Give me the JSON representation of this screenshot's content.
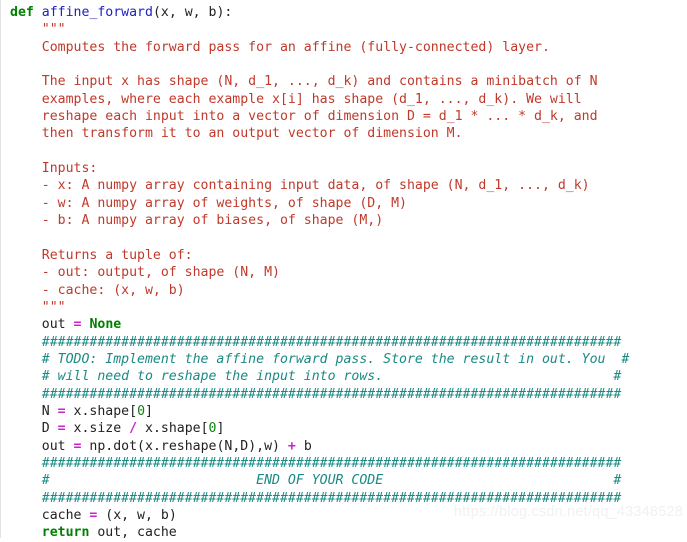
{
  "editor": {
    "language": "python",
    "background_color": "#ffffff",
    "gutter_border_color": "#e3e3e3",
    "theme_colors": {
      "keyword": "#008000",
      "function_name": "#2020c0",
      "string": "#c0392b",
      "comment": "#1a8a84",
      "operator": "#cc22cc",
      "number": "#108010",
      "plain_text": "#222222"
    }
  },
  "watermark": {
    "text": "https://blog.csdn.net/qq_43348528",
    "color": "#f1f1f1"
  },
  "code": {
    "lines": [
      {
        "id": "l1",
        "segments": [
          {
            "t": "def",
            "c": "keyword"
          },
          {
            "t": " ",
            "c": "plain"
          },
          {
            "t": "affine_forward",
            "c": "funcname"
          },
          {
            "t": "(x, w, b):",
            "c": "plain"
          }
        ]
      },
      {
        "id": "l2",
        "segments": [
          {
            "t": "    \"\"\"",
            "c": "string"
          }
        ]
      },
      {
        "id": "l3",
        "segments": [
          {
            "t": "    Computes the forward pass for an affine (fully-connected) layer.",
            "c": "string"
          }
        ]
      },
      {
        "id": "l4",
        "segments": [
          {
            "t": "",
            "c": "string"
          }
        ]
      },
      {
        "id": "l5",
        "segments": [
          {
            "t": "    The input x has shape (N, d_1, ..., d_k) and contains a minibatch of N",
            "c": "string"
          }
        ]
      },
      {
        "id": "l6",
        "segments": [
          {
            "t": "    examples, where each example x[i] has shape (d_1, ..., d_k). We will",
            "c": "string"
          }
        ]
      },
      {
        "id": "l7",
        "segments": [
          {
            "t": "    reshape each input into a vector of dimension D = d_1 * ... * d_k, and",
            "c": "string"
          }
        ]
      },
      {
        "id": "l8",
        "segments": [
          {
            "t": "    then transform it to an output vector of dimension M.",
            "c": "string"
          }
        ]
      },
      {
        "id": "l9",
        "segments": [
          {
            "t": "",
            "c": "string"
          }
        ]
      },
      {
        "id": "l10",
        "segments": [
          {
            "t": "    Inputs:",
            "c": "string"
          }
        ]
      },
      {
        "id": "l11",
        "segments": [
          {
            "t": "    - x: A numpy array containing input data, of shape (N, d_1, ..., d_k)",
            "c": "string"
          }
        ]
      },
      {
        "id": "l12",
        "segments": [
          {
            "t": "    - w: A numpy array of weights, of shape (D, M)",
            "c": "string"
          }
        ]
      },
      {
        "id": "l13",
        "segments": [
          {
            "t": "    - b: A numpy array of biases, of shape (M,)",
            "c": "string"
          }
        ]
      },
      {
        "id": "l14",
        "segments": [
          {
            "t": "",
            "c": "string"
          }
        ]
      },
      {
        "id": "l15",
        "segments": [
          {
            "t": "    Returns a tuple of:",
            "c": "string"
          }
        ]
      },
      {
        "id": "l16",
        "segments": [
          {
            "t": "    - out: output, of shape (N, M)",
            "c": "string"
          }
        ]
      },
      {
        "id": "l17",
        "segments": [
          {
            "t": "    - cache: (x, w, b)",
            "c": "string"
          }
        ]
      },
      {
        "id": "l18",
        "segments": [
          {
            "t": "    \"\"\"",
            "c": "string"
          }
        ]
      },
      {
        "id": "l19",
        "segments": [
          {
            "t": "    out ",
            "c": "plain"
          },
          {
            "t": "=",
            "c": "operator"
          },
          {
            "t": " ",
            "c": "plain"
          },
          {
            "t": "None",
            "c": "const"
          }
        ]
      },
      {
        "id": "l20",
        "segments": [
          {
            "t": "    #########################################################################",
            "c": "comment"
          }
        ]
      },
      {
        "id": "l21",
        "segments": [
          {
            "t": "    # TODO: Implement the affine forward pass. Store the result in out. You  #",
            "c": "comment"
          }
        ]
      },
      {
        "id": "l22",
        "segments": [
          {
            "t": "    # will need to reshape the input into rows.                             #",
            "c": "comment"
          }
        ]
      },
      {
        "id": "l23",
        "segments": [
          {
            "t": "    #########################################################################",
            "c": "comment"
          }
        ]
      },
      {
        "id": "l24",
        "segments": [
          {
            "t": "    N ",
            "c": "plain"
          },
          {
            "t": "=",
            "c": "operator"
          },
          {
            "t": " x.shape[",
            "c": "plain"
          },
          {
            "t": "0",
            "c": "number"
          },
          {
            "t": "]",
            "c": "plain"
          }
        ]
      },
      {
        "id": "l25",
        "segments": [
          {
            "t": "    D ",
            "c": "plain"
          },
          {
            "t": "=",
            "c": "operator"
          },
          {
            "t": " x.size ",
            "c": "plain"
          },
          {
            "t": "/",
            "c": "operator"
          },
          {
            "t": " x.shape[",
            "c": "plain"
          },
          {
            "t": "0",
            "c": "number"
          },
          {
            "t": "]",
            "c": "plain"
          }
        ]
      },
      {
        "id": "l26",
        "segments": [
          {
            "t": "    out ",
            "c": "plain"
          },
          {
            "t": "=",
            "c": "operator"
          },
          {
            "t": " np.dot(x.reshape(N,D),w) ",
            "c": "plain"
          },
          {
            "t": "+",
            "c": "operator"
          },
          {
            "t": " b",
            "c": "plain"
          }
        ]
      },
      {
        "id": "l27",
        "segments": [
          {
            "t": "    #########################################################################",
            "c": "comment"
          }
        ]
      },
      {
        "id": "l28",
        "segments": [
          {
            "t": "    #                          END OF YOUR CODE                             #",
            "c": "comment"
          }
        ]
      },
      {
        "id": "l29",
        "segments": [
          {
            "t": "    #########################################################################",
            "c": "comment"
          }
        ]
      },
      {
        "id": "l30",
        "segments": [
          {
            "t": "    cache ",
            "c": "plain"
          },
          {
            "t": "=",
            "c": "operator"
          },
          {
            "t": " (x, w, b)",
            "c": "plain"
          }
        ]
      },
      {
        "id": "l31",
        "segments": [
          {
            "t": "    ",
            "c": "plain"
          },
          {
            "t": "return",
            "c": "keyword"
          },
          {
            "t": " out, cache",
            "c": "plain"
          }
        ]
      }
    ]
  }
}
